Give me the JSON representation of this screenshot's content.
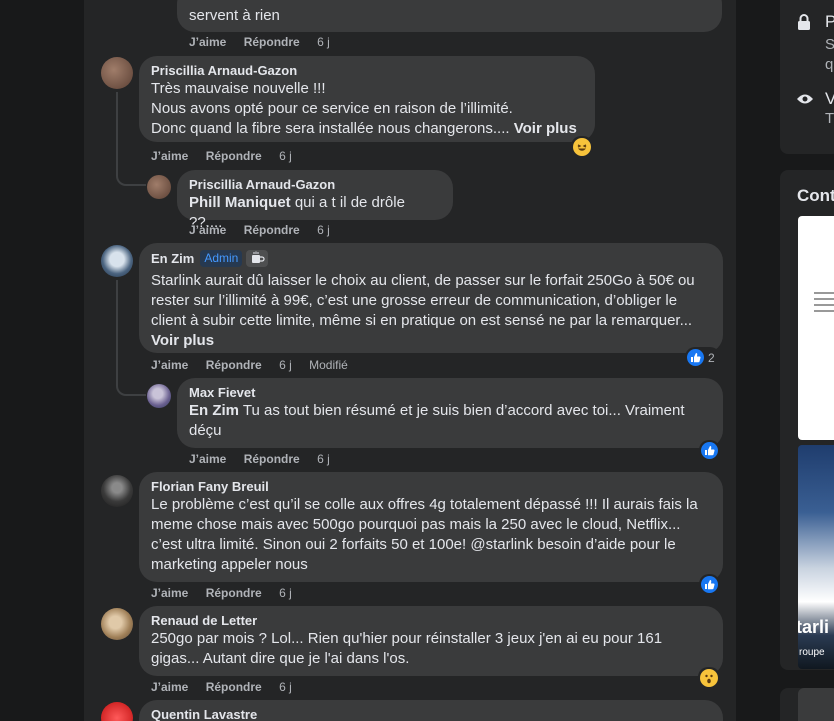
{
  "comments": [
    {
      "text": "servent à rien",
      "like": "J’aime",
      "reply": "Répondre",
      "time": "6 j"
    },
    {
      "author": "Priscillia Arnaud-Gazon",
      "lines": [
        "Très mauvaise nouvelle !!!",
        "Nous avons opté pour ce service en raison de l’illimité."
      ],
      "line3": "Donc quand la fibre sera installée nous changerons....",
      "seemore": "Voir plus",
      "like": "J’aime",
      "reply": "Répondre",
      "time": "6 j",
      "reaction": "laugh-emoji"
    },
    {
      "author": "Priscillia Arnaud-Gazon",
      "mention": "Phill Maniquet",
      "text": " qui a t il de drôle ??....",
      "like": "J’aime",
      "reply": "Répondre",
      "time": "6 j"
    },
    {
      "author": "En Zim",
      "badge": "Admin",
      "text": "Starlink aurait dû laisser le choix au client, de passer sur le forfait 250Go à 50€ ou rester sur l’illimité à 99€, c’est une grosse erreur de communication, d’obliger le client à subir cette limite, même si en pratique on est sensé ne par la remarquer...",
      "seemore": "Voir plus",
      "like": "J’aime",
      "reply": "Répondre",
      "time": "6 j",
      "edited": "Modifié",
      "reaction_count": "2"
    },
    {
      "author": "Max Fievet",
      "mention": "En Zim",
      "text": " Tu as tout bien résumé et je suis bien d’accord avec toi... Vraiment déçu",
      "like": "J’aime",
      "reply": "Répondre",
      "time": "6 j"
    },
    {
      "author": "Florian Fany Breuil",
      "text": "Le problème c’est qu’il se colle aux offres 4g totalement dépassé !!! Il aurais fais la meme chose mais avec 500go pourquoi pas mais la 250 avec le cloud, Netflix... c’est ultra limité. Sinon oui 2 forfaits 50 et 100e! @starlink besoin d’aide pour le marketing appeler nous",
      "like": "J’aime",
      "reply": "Répondre",
      "time": "6 j"
    },
    {
      "author": "Renaud de Letter",
      "text": "250go par mois ? Lol... Rien qu'hier pour réinstaller 3 jeux j'en ai eu pour 161 gigas... Autant dire que je l'ai dans l'os.",
      "like": "J’aime",
      "reply": "Répondre",
      "time": "6 j",
      "reaction": "wow-emoji"
    },
    {
      "author": "Quentin Lavastre"
    }
  ],
  "sidebar": {
    "row1_letter": "P",
    "row1_sub1": "S",
    "row1_sub2": "q",
    "row2_letter": "V",
    "row2_sub": "T",
    "section_title": "Cont",
    "thumb_caption": "tarli",
    "thumb_caption2": "roupe",
    "icons": [
      "lock-icon",
      "eye-icon"
    ]
  },
  "colors": {
    "background": "#18191a",
    "card": "#242526",
    "bubble": "#3a3b3c",
    "text": "#e4e6eb",
    "secondary": "#b0b3b8",
    "accent": "#1877f2",
    "admin": "#4599ff"
  }
}
